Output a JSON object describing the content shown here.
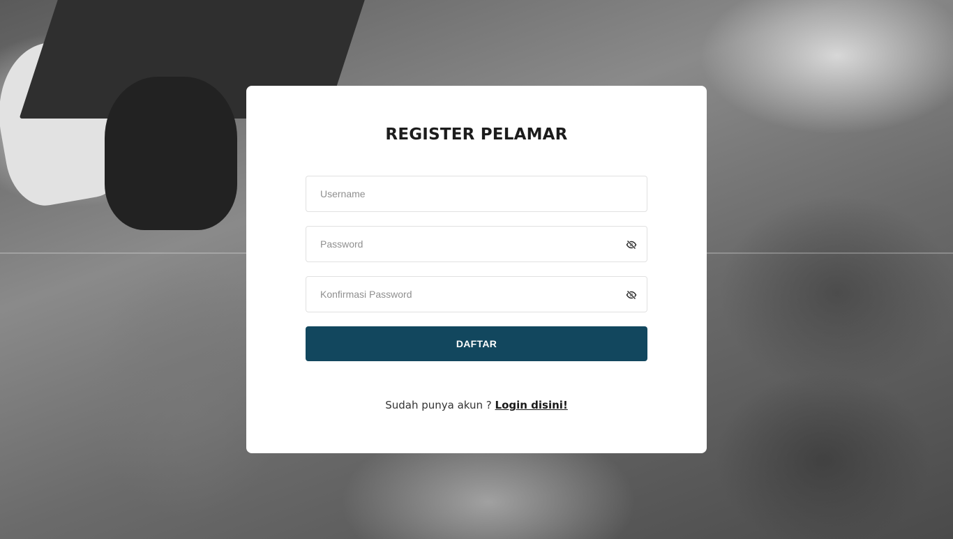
{
  "form": {
    "title": "REGISTER PELAMAR",
    "username": {
      "placeholder": "Username",
      "value": ""
    },
    "password": {
      "placeholder": "Password",
      "value": "",
      "toggle_icon": "eye-slash-icon"
    },
    "confirm_password": {
      "placeholder": "Konfirmasi Password",
      "value": "",
      "toggle_icon": "eye-slash-icon"
    },
    "submit_label": "DAFTAR"
  },
  "footer": {
    "prompt": "Sudah punya akun ? ",
    "login_link": "Login disini!"
  },
  "colors": {
    "button": "#12475e",
    "card": "#ffffff",
    "title": "#1c1c1c"
  },
  "background": {
    "image": "graduation-ceremony-photo",
    "filter": "grayscale"
  }
}
